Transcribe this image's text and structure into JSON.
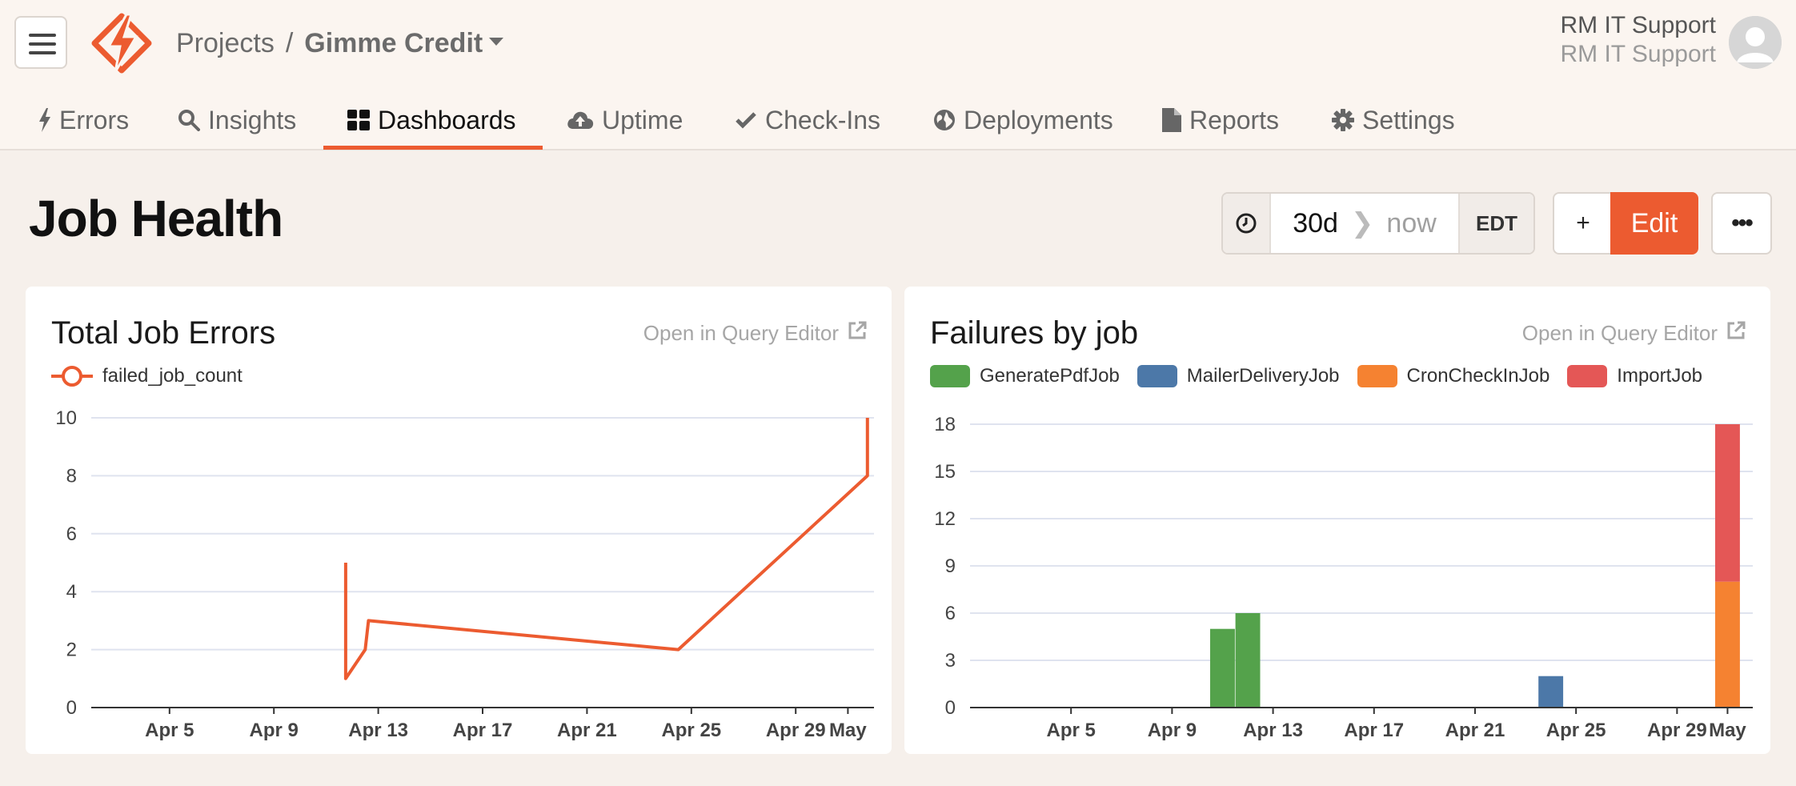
{
  "header": {
    "breadcrumb_projects": "Projects",
    "breadcrumb_sep": "/",
    "project_name": "Gimme Credit",
    "user_name": "RM IT Support",
    "user_org": "RM IT Support"
  },
  "tabs": [
    {
      "label": "Errors",
      "icon": "bolt-icon"
    },
    {
      "label": "Insights",
      "icon": "search-icon"
    },
    {
      "label": "Dashboards",
      "icon": "dashboard-grid-icon",
      "active": true
    },
    {
      "label": "Uptime",
      "icon": "cloud-upload-icon"
    },
    {
      "label": "Check-Ins",
      "icon": "check-icon"
    },
    {
      "label": "Deployments",
      "icon": "globe-icon"
    },
    {
      "label": "Reports",
      "icon": "file-icon"
    },
    {
      "label": "Settings",
      "icon": "gear-icon"
    }
  ],
  "dashboard": {
    "title": "Job Health",
    "time_from": "30d",
    "time_to": "now",
    "timezone": "EDT",
    "add_label": "+",
    "edit_label": "Edit",
    "more_label": "•••"
  },
  "colors": {
    "accent": "#ec5b30",
    "generate_pdf": "#54a24b",
    "mailer": "#4c78a8",
    "cron": "#f58231",
    "import": "#e45756"
  },
  "cards": {
    "left": {
      "title": "Total Job Errors",
      "link": "Open in Query Editor"
    },
    "right": {
      "title": "Failures by job",
      "link": "Open in Query Editor"
    }
  },
  "chart_data": [
    {
      "type": "line",
      "title": "Total Job Errors",
      "legend": [
        "failed_job_count"
      ],
      "x_ticks": [
        "Apr 5",
        "Apr 9",
        "Apr 13",
        "Apr 17",
        "Apr 21",
        "Apr 25",
        "Apr 29",
        "May"
      ],
      "y_ticks": [
        0,
        2,
        4,
        6,
        8,
        10
      ],
      "ylim": [
        0,
        10
      ],
      "xlim": [
        "2025-04-02",
        "2025-05-02"
      ],
      "series": [
        {
          "name": "failed_job_count",
          "points": [
            {
              "x": "2025-04-11T18:00",
              "y": 5
            },
            {
              "x": "2025-04-11T18:00",
              "y": 1
            },
            {
              "x": "2025-04-12T12:00",
              "y": 2
            },
            {
              "x": "2025-04-12T15:00",
              "y": 3
            },
            {
              "x": "2025-04-24T12:00",
              "y": 2
            },
            {
              "x": "2025-05-01T18:00",
              "y": 8
            },
            {
              "x": "2025-05-01T18:00",
              "y": 10
            }
          ]
        }
      ]
    },
    {
      "type": "bar",
      "stacked": true,
      "title": "Failures by job",
      "x_ticks": [
        "Apr 5",
        "Apr 9",
        "Apr 13",
        "Apr 17",
        "Apr 21",
        "Apr 25",
        "Apr 29",
        "May"
      ],
      "y_ticks": [
        0,
        3,
        6,
        9,
        12,
        15,
        18
      ],
      "ylim": [
        0,
        18
      ],
      "xlim": [
        "2025-04-01",
        "2025-05-02"
      ],
      "series": [
        {
          "name": "GeneratePdfJob",
          "bars": [
            {
              "x": "2025-04-11",
              "y": 5
            },
            {
              "x": "2025-04-12",
              "y": 6
            }
          ]
        },
        {
          "name": "MailerDeliveryJob",
          "bars": [
            {
              "x": "2025-04-24",
              "y": 2
            }
          ]
        },
        {
          "name": "CronCheckInJob",
          "bars": [
            {
              "x": "2025-05-01",
              "y": 8
            }
          ]
        },
        {
          "name": "ImportJob",
          "bars": [
            {
              "x": "2025-05-01",
              "y": 10
            }
          ]
        }
      ]
    }
  ]
}
